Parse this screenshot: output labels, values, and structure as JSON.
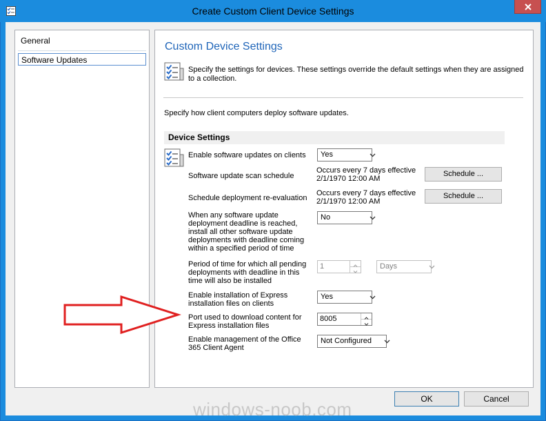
{
  "window": {
    "title": "Create Custom Client Device Settings",
    "app_icon": "settings-checklist-icon",
    "close_icon": "close-x-icon",
    "accent_color": "#1b8cde"
  },
  "nav": {
    "items": [
      {
        "label": "General",
        "selected": false
      },
      {
        "label": "Software Updates",
        "selected": true
      }
    ]
  },
  "panel": {
    "title": "Custom Device Settings",
    "title_color": "#1e64b8",
    "description": "Specify the settings for devices. These settings override the default settings when they are assigned to a collection.",
    "intro": "Specify how client computers deploy software updates.",
    "section_header": "Device Settings",
    "settings": {
      "enable_updates": {
        "label": "Enable software updates on clients",
        "value": "Yes"
      },
      "scan_schedule": {
        "label": "Software update scan schedule",
        "value": "Occurs every 7 days effective 2/1/1970 12:00 AM",
        "button": "Schedule ..."
      },
      "reeval_schedule": {
        "label": "Schedule deployment re-evaluation",
        "value": "Occurs every 7 days effective 2/1/1970 12:00 AM",
        "button": "Schedule ..."
      },
      "deadline_install": {
        "label": "When any software update deployment deadline is reached, install all other software update deployments with deadline coming within a specified period of time",
        "value": "No"
      },
      "period": {
        "label": "Period of time for which all pending deployments with deadline in this time will also be installed",
        "value": "1",
        "unit": "Days",
        "disabled": true
      },
      "express_install": {
        "label": "Enable installation of Express installation files on clients",
        "value": "Yes"
      },
      "express_port": {
        "label": "Port used to download content for Express installation files",
        "value": "8005"
      },
      "o365": {
        "label": "Enable management of the Office 365 Client Agent",
        "value": "Not Configured"
      }
    }
  },
  "buttons": {
    "ok": "OK",
    "cancel": "Cancel"
  },
  "watermark": "windows-noob.com",
  "annotation": {
    "arrow_color": "#e02020",
    "direction": "right"
  }
}
